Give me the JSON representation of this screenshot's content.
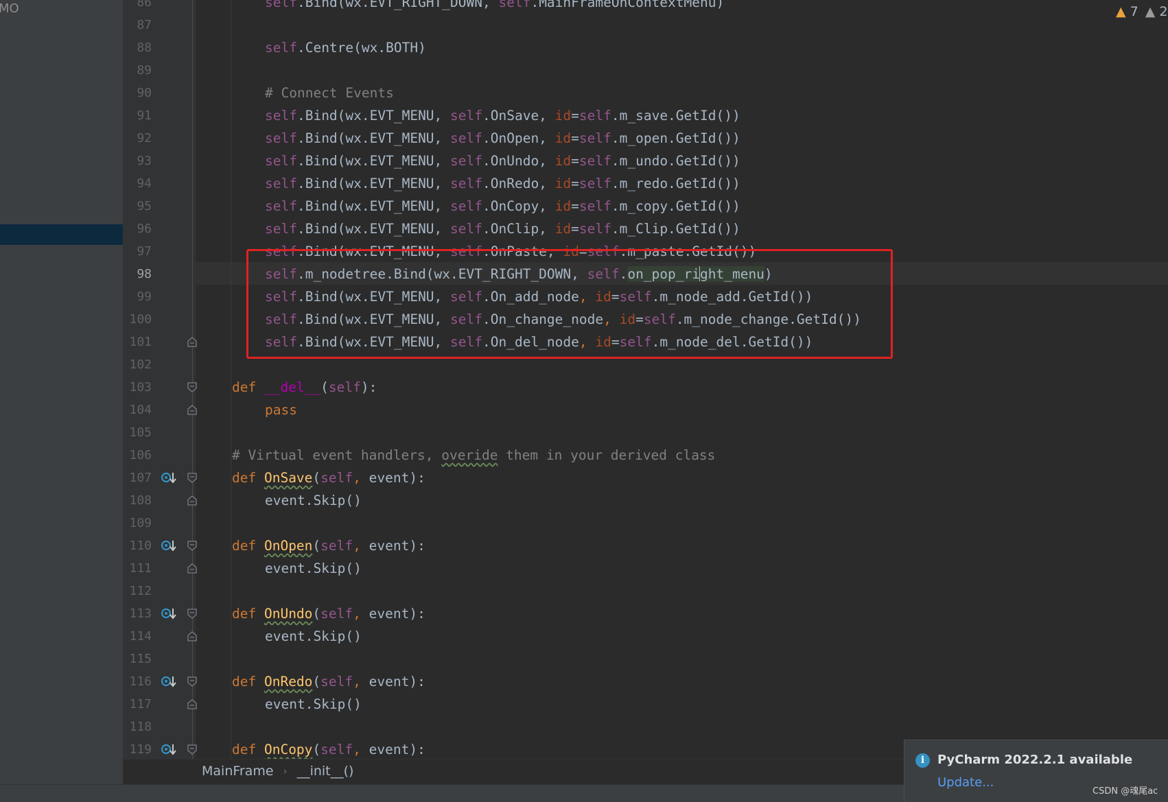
{
  "project_panel": {
    "partial_label": "MO"
  },
  "inspection": {
    "warnings": "7",
    "weak_warnings": "2"
  },
  "lines": [
    {
      "n": "86",
      "indent": 1,
      "tokens": [
        [
          "self",
          "self"
        ],
        [
          "",
          "."
        ],
        [
          "",
          "Bind(wx.EVT_RIGHT_DOWN, "
        ],
        [
          "self",
          "self"
        ],
        [
          "",
          ".MainFrameOnContextMenu)"
        ]
      ]
    },
    {
      "n": "87",
      "tokens": []
    },
    {
      "n": "88",
      "indent": 1,
      "tokens": [
        [
          "self",
          "self"
        ],
        [
          "",
          ".Centre(wx.BOTH)"
        ]
      ]
    },
    {
      "n": "89",
      "tokens": []
    },
    {
      "n": "90",
      "indent": 1,
      "tokens": [
        [
          "cm",
          "# Connect Events"
        ]
      ]
    },
    {
      "n": "91",
      "indent": 1,
      "tokens": [
        [
          "self",
          "self"
        ],
        [
          "",
          ".Bind(wx.EVT_MENU, "
        ],
        [
          "self",
          "self"
        ],
        [
          "",
          ".OnSave, "
        ],
        [
          "param",
          "id"
        ],
        [
          "",
          "="
        ],
        [
          "self",
          "self"
        ],
        [
          "",
          ".m_save.GetId())"
        ]
      ]
    },
    {
      "n": "92",
      "indent": 1,
      "tokens": [
        [
          "self",
          "self"
        ],
        [
          "",
          ".Bind(wx.EVT_MENU, "
        ],
        [
          "self",
          "self"
        ],
        [
          "",
          ".OnOpen, "
        ],
        [
          "param",
          "id"
        ],
        [
          "",
          "="
        ],
        [
          "self",
          "self"
        ],
        [
          "",
          ".m_open.GetId())"
        ]
      ]
    },
    {
      "n": "93",
      "indent": 1,
      "tokens": [
        [
          "self",
          "self"
        ],
        [
          "",
          ".Bind(wx.EVT_MENU, "
        ],
        [
          "self",
          "self"
        ],
        [
          "",
          ".OnUndo, "
        ],
        [
          "param",
          "id"
        ],
        [
          "",
          "="
        ],
        [
          "self",
          "self"
        ],
        [
          "",
          ".m_undo.GetId())"
        ]
      ]
    },
    {
      "n": "94",
      "indent": 1,
      "tokens": [
        [
          "self",
          "self"
        ],
        [
          "",
          ".Bind(wx.EVT_MENU, "
        ],
        [
          "self",
          "self"
        ],
        [
          "",
          ".OnRedo, "
        ],
        [
          "param",
          "id"
        ],
        [
          "",
          "="
        ],
        [
          "self",
          "self"
        ],
        [
          "",
          ".m_redo.GetId())"
        ]
      ]
    },
    {
      "n": "95",
      "indent": 1,
      "tokens": [
        [
          "self",
          "self"
        ],
        [
          "",
          ".Bind(wx.EVT_MENU, "
        ],
        [
          "self",
          "self"
        ],
        [
          "",
          ".OnCopy, "
        ],
        [
          "param",
          "id"
        ],
        [
          "",
          "="
        ],
        [
          "self",
          "self"
        ],
        [
          "",
          ".m_copy.GetId())"
        ]
      ]
    },
    {
      "n": "96",
      "indent": 1,
      "tokens": [
        [
          "self",
          "self"
        ],
        [
          "",
          ".Bind(wx.EVT_MENU, "
        ],
        [
          "self",
          "self"
        ],
        [
          "",
          ".OnClip, "
        ],
        [
          "param",
          "id"
        ],
        [
          "",
          "="
        ],
        [
          "self",
          "self"
        ],
        [
          "",
          ".m_Clip.GetId())"
        ]
      ]
    },
    {
      "n": "97",
      "indent": 1,
      "tokens": [
        [
          "self",
          "self"
        ],
        [
          "",
          ".Bind(wx.EVT_MENU, "
        ],
        [
          "self",
          "self"
        ],
        [
          "",
          ".OnPaste, "
        ],
        [
          "param",
          "id"
        ],
        [
          "",
          "="
        ],
        [
          "self",
          "self"
        ],
        [
          "",
          ".m_paste.GetId())"
        ]
      ]
    },
    {
      "n": "98",
      "indent": 1,
      "current": true,
      "tokens": [
        [
          "self",
          "self"
        ],
        [
          "",
          ".m_nodetree.Bind(wx.EVT_RIGHT_DOWN, "
        ],
        [
          "self",
          "self"
        ],
        [
          "",
          "."
        ],
        [
          "hl",
          "on_pop_ri"
        ],
        [
          "caret",
          ""
        ],
        [
          "hl",
          "ght_menu"
        ],
        [
          "",
          ")"
        ]
      ]
    },
    {
      "n": "99",
      "indent": 1,
      "tokens": [
        [
          "self",
          "self"
        ],
        [
          "",
          ".Bind(wx.EVT_MENU, "
        ],
        [
          "self",
          "self"
        ],
        [
          "",
          ".On_add_node"
        ],
        [
          "kw",
          ","
        ],
        [
          "",
          " "
        ],
        [
          "param",
          "id"
        ],
        [
          "",
          "="
        ],
        [
          "self",
          "self"
        ],
        [
          "",
          ".m_node_add.GetId())"
        ]
      ]
    },
    {
      "n": "100",
      "indent": 1,
      "tokens": [
        [
          "self",
          "self"
        ],
        [
          "",
          ".Bind(wx.EVT_MENU, "
        ],
        [
          "self",
          "self"
        ],
        [
          "",
          ".On_change_node"
        ],
        [
          "kw",
          ","
        ],
        [
          "",
          " "
        ],
        [
          "param",
          "id"
        ],
        [
          "",
          "="
        ],
        [
          "self",
          "self"
        ],
        [
          "",
          ".m_node_change.GetId())"
        ]
      ]
    },
    {
      "n": "101",
      "indent": 1,
      "fold": "end",
      "tokens": [
        [
          "self",
          "self"
        ],
        [
          "",
          ".Bind(wx.EVT_MENU, "
        ],
        [
          "self",
          "self"
        ],
        [
          "",
          ".On_del_node"
        ],
        [
          "kw",
          ","
        ],
        [
          "",
          " "
        ],
        [
          "param",
          "id"
        ],
        [
          "",
          "="
        ],
        [
          "self",
          "self"
        ],
        [
          "",
          ".m_node_del.GetId())"
        ]
      ]
    },
    {
      "n": "102",
      "tokens": []
    },
    {
      "n": "103",
      "indent": 0,
      "fold": "start",
      "tokens": [
        [
          "kw",
          "def "
        ],
        [
          "magic",
          "__del__"
        ],
        [
          "",
          "("
        ],
        [
          "self",
          "self"
        ],
        [
          "",
          "):"
        ]
      ]
    },
    {
      "n": "104",
      "indent": 1,
      "fold": "end",
      "tokens": [
        [
          "kw",
          "pass"
        ]
      ]
    },
    {
      "n": "105",
      "tokens": []
    },
    {
      "n": "106",
      "indent": 0,
      "tokens": [
        [
          "cm",
          "# Virtual event handlers, "
        ],
        [
          "cm typo",
          "overide"
        ],
        [
          "cm",
          " them in your derived class"
        ]
      ]
    },
    {
      "n": "107",
      "indent": 0,
      "fold": "start",
      "override": true,
      "tokens": [
        [
          "kw",
          "def "
        ],
        [
          "fn warn",
          "OnSave"
        ],
        [
          "",
          "("
        ],
        [
          "self",
          "self"
        ],
        [
          "kw",
          ","
        ],
        [
          "",
          " event):"
        ]
      ]
    },
    {
      "n": "108",
      "indent": 1,
      "fold": "end",
      "tokens": [
        [
          "",
          "event.Skip()"
        ]
      ]
    },
    {
      "n": "109",
      "tokens": []
    },
    {
      "n": "110",
      "indent": 0,
      "fold": "start",
      "override": true,
      "tokens": [
        [
          "kw",
          "def "
        ],
        [
          "fn warn",
          "OnOpen"
        ],
        [
          "",
          "("
        ],
        [
          "self",
          "self"
        ],
        [
          "kw",
          ","
        ],
        [
          "",
          " event):"
        ]
      ]
    },
    {
      "n": "111",
      "indent": 1,
      "fold": "end",
      "tokens": [
        [
          "",
          "event.Skip()"
        ]
      ]
    },
    {
      "n": "112",
      "tokens": []
    },
    {
      "n": "113",
      "indent": 0,
      "fold": "start",
      "override": true,
      "tokens": [
        [
          "kw",
          "def "
        ],
        [
          "fn warn",
          "OnUndo"
        ],
        [
          "",
          "("
        ],
        [
          "self",
          "self"
        ],
        [
          "kw",
          ","
        ],
        [
          "",
          " event):"
        ]
      ]
    },
    {
      "n": "114",
      "indent": 1,
      "fold": "end",
      "tokens": [
        [
          "",
          "event.Skip()"
        ]
      ]
    },
    {
      "n": "115",
      "tokens": []
    },
    {
      "n": "116",
      "indent": 0,
      "fold": "start",
      "override": true,
      "tokens": [
        [
          "kw",
          "def "
        ],
        [
          "fn warn",
          "OnRedo"
        ],
        [
          "",
          "("
        ],
        [
          "self",
          "self"
        ],
        [
          "kw",
          ","
        ],
        [
          "",
          " event):"
        ]
      ]
    },
    {
      "n": "117",
      "indent": 1,
      "fold": "end",
      "tokens": [
        [
          "",
          "event.Skip()"
        ]
      ]
    },
    {
      "n": "118",
      "tokens": []
    },
    {
      "n": "119",
      "indent": 0,
      "fold": "start",
      "override": true,
      "tokens": [
        [
          "kw",
          "def "
        ],
        [
          "fn warn",
          "OnCopy"
        ],
        [
          "",
          "("
        ],
        [
          "self",
          "self"
        ],
        [
          "kw",
          ","
        ],
        [
          "",
          " event):"
        ]
      ]
    }
  ],
  "breadcrumb": {
    "class_name": "MainFrame",
    "method_name": "__init__()"
  },
  "notification": {
    "title": "PyCharm 2022.2.1 available",
    "action": "Update..."
  },
  "watermark": "CSDN @魂尾ac"
}
